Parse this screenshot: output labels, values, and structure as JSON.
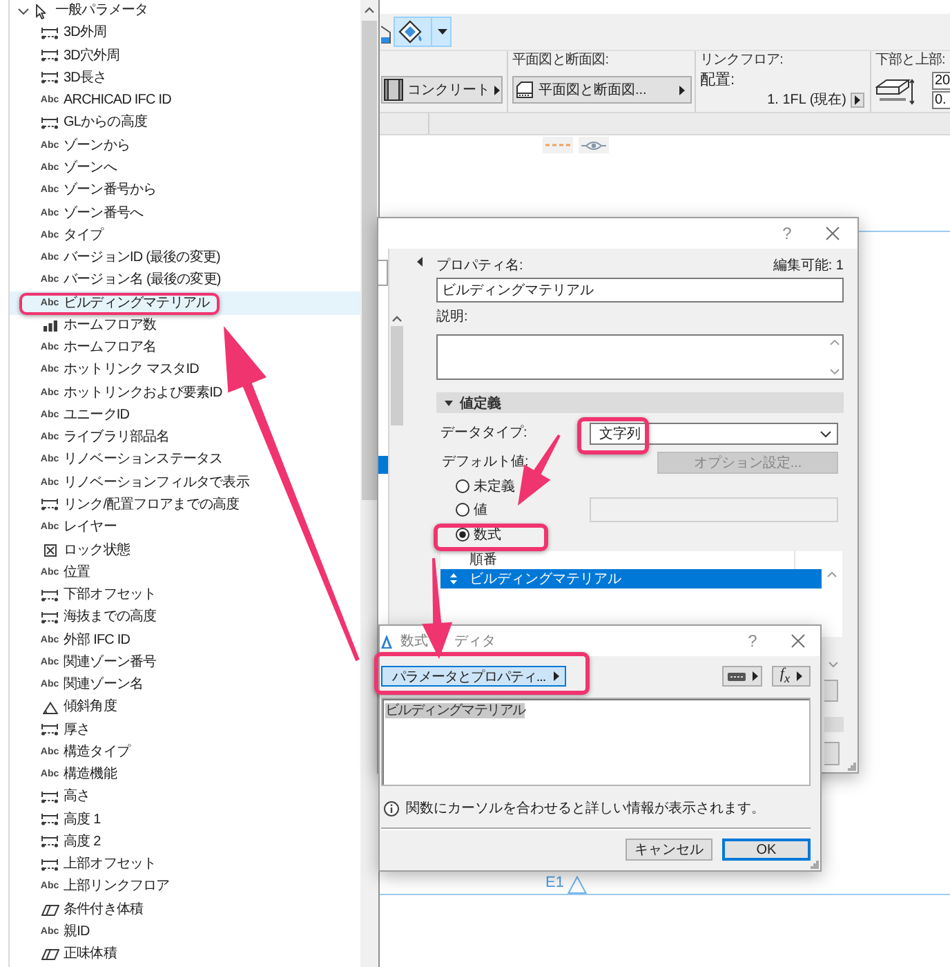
{
  "parameter_tree": [
    {
      "label": "一般パラメータ",
      "expanded": true,
      "children": [
        {
          "label": "3D外周",
          "kind": "length",
          "selected": false,
          "callout": false
        },
        {
          "label": "3D穴外周",
          "kind": "length",
          "selected": false,
          "callout": false
        },
        {
          "label": "3D長さ",
          "kind": "length",
          "selected": false,
          "callout": false
        },
        {
          "label": "ARCHICAD IFC ID",
          "kind": "text",
          "icon_text": "Abc",
          "selected": false,
          "callout": false
        },
        {
          "label": "GLからの高度",
          "kind": "length",
          "selected": false,
          "callout": false
        },
        {
          "label": "ゾーンから",
          "kind": "text",
          "icon_text": "Abc",
          "selected": false,
          "callout": false
        },
        {
          "label": "ゾーンへ",
          "kind": "text",
          "icon_text": "Abc",
          "selected": false,
          "callout": false
        },
        {
          "label": "ゾーン番号から",
          "kind": "text",
          "icon_text": "Abc",
          "selected": false,
          "callout": false
        },
        {
          "label": "ゾーン番号へ",
          "kind": "text",
          "icon_text": "Abc",
          "selected": false,
          "callout": false
        },
        {
          "label": "タイプ",
          "kind": "text",
          "icon_text": "Abc",
          "selected": false,
          "callout": false
        },
        {
          "label": "バージョンID (最後の変更)",
          "kind": "text",
          "icon_text": "Abc",
          "selected": false,
          "callout": false
        },
        {
          "label": "バージョン名 (最後の変更)",
          "kind": "text",
          "icon_text": "Abc",
          "selected": false,
          "callout": false
        },
        {
          "label": "ビルディングマテリアル",
          "kind": "text",
          "icon_text": "Abc",
          "selected": true,
          "callout": true
        },
        {
          "label": "ホームフロア数",
          "kind": "count",
          "selected": false,
          "callout": false
        },
        {
          "label": "ホームフロア名",
          "kind": "text",
          "icon_text": "Abc",
          "selected": false,
          "callout": false
        },
        {
          "label": "ホットリンク マスタID",
          "kind": "text",
          "icon_text": "Abc",
          "selected": false,
          "callout": false
        },
        {
          "label": "ホットリンクおよび要素ID",
          "kind": "text",
          "icon_text": "Abc",
          "selected": false,
          "callout": false
        },
        {
          "label": "ユニークID",
          "kind": "text",
          "icon_text": "Abc",
          "selected": false,
          "callout": false
        },
        {
          "label": "ライブラリ部品名",
          "kind": "text",
          "icon_text": "Abc",
          "selected": false,
          "callout": false
        },
        {
          "label": "リノベーションステータス",
          "kind": "text",
          "icon_text": "Abc",
          "selected": false,
          "callout": false
        },
        {
          "label": "リノベーションフィルタで表示",
          "kind": "text",
          "icon_text": "Abc",
          "selected": false,
          "callout": false
        },
        {
          "label": "リンク/配置フロアまでの高度",
          "kind": "length",
          "selected": false,
          "callout": false
        },
        {
          "label": "レイヤー",
          "kind": "text",
          "icon_text": "Abc",
          "selected": false,
          "callout": false
        },
        {
          "label": "ロック状態",
          "kind": "lock",
          "selected": false,
          "callout": false
        },
        {
          "label": "位置",
          "kind": "text",
          "icon_text": "Abc",
          "selected": false,
          "callout": false
        },
        {
          "label": "下部オフセット",
          "kind": "length",
          "selected": false,
          "callout": false
        },
        {
          "label": "海抜までの高度",
          "kind": "length",
          "selected": false,
          "callout": false
        },
        {
          "label": "外部 IFC ID",
          "kind": "text",
          "icon_text": "Abc",
          "selected": false,
          "callout": false
        },
        {
          "label": "関連ゾーン番号",
          "kind": "text",
          "icon_text": "Abc",
          "selected": false,
          "callout": false
        },
        {
          "label": "関連ゾーン名",
          "kind": "text",
          "icon_text": "Abc",
          "selected": false,
          "callout": false
        },
        {
          "label": "傾斜角度",
          "kind": "angle",
          "selected": false,
          "callout": false
        },
        {
          "label": "厚さ",
          "kind": "length",
          "selected": false,
          "callout": false
        },
        {
          "label": "構造タイプ",
          "kind": "text",
          "icon_text": "Abc",
          "selected": false,
          "callout": false
        },
        {
          "label": "構造機能",
          "kind": "text",
          "icon_text": "Abc",
          "selected": false,
          "callout": false
        },
        {
          "label": "高さ",
          "kind": "length",
          "selected": false,
          "callout": false
        },
        {
          "label": "高度 1",
          "kind": "length",
          "selected": false,
          "callout": false
        },
        {
          "label": "高度 2",
          "kind": "length",
          "selected": false,
          "callout": false
        },
        {
          "label": "上部オフセット",
          "kind": "length",
          "selected": false,
          "callout": false
        },
        {
          "label": "上部リンクフロア",
          "kind": "text",
          "icon_text": "Abc",
          "selected": false,
          "callout": false
        },
        {
          "label": "条件付き体積",
          "kind": "volume",
          "selected": false,
          "callout": false
        },
        {
          "label": "親ID",
          "kind": "text",
          "icon_text": "Abc",
          "selected": false,
          "callout": false
        },
        {
          "label": "正味体積",
          "kind": "volume",
          "selected": false,
          "callout": false
        }
      ]
    }
  ],
  "toolbar": {
    "buttons": [
      {
        "kind": "house",
        "selected": false
      },
      {
        "kind": "fill",
        "selected": true
      }
    ]
  },
  "info_box": {
    "material": {
      "label": "コンクリート"
    },
    "floor_plan": {
      "caption": "平面図と断面図:",
      "button": "平面図と断面図..."
    },
    "link_floor": {
      "caption": "リンクフロア:",
      "label": "配置:",
      "value": "1. 1FL (現在)"
    },
    "top_bottom": {
      "caption": "下部と上部:",
      "fields": [
        "20",
        "0."
      ]
    }
  },
  "canvas": {
    "elevation_marker": {
      "label": "E1"
    }
  },
  "property_dialog": {
    "help": "?",
    "name_label": "プロパティ名:",
    "edit_status": "編集可能: 1",
    "name_value": "ビルディングマテリアル",
    "description_label": "説明:",
    "section": {
      "label": "値定義",
      "expanded": true
    },
    "data_type_label": "データタイプ:",
    "data_type": {
      "value": "文字列",
      "callout": true
    },
    "default_label": "デフォルト値:",
    "options_button": {
      "label": "オプション設定...",
      "disabled": true
    },
    "default_options": [
      {
        "label": "未定義",
        "selected": false,
        "callout": false
      },
      {
        "label": "値",
        "selected": false,
        "callout": false
      },
      {
        "label": "数式",
        "selected": true,
        "callout": true
      }
    ],
    "value_field": {
      "disabled": true
    },
    "order_table": {
      "header": "順番",
      "rows": [
        {
          "label": "ビルディングマテリアル",
          "selected": true
        }
      ]
    }
  },
  "formula_editor": {
    "title_parts": [
      "数式",
      "ディタ"
    ],
    "help": "?",
    "parameter_button": {
      "label": "パラメータとプロパティ...",
      "callout": true
    },
    "function_button": {
      "label": "f$_{x}$"
    },
    "formula": {
      "text": "ビルディングマテリアル",
      "selected": true
    },
    "info": "関数にカーソルを合わせると詳しい情報が表示されます。",
    "buttons": [
      {
        "label": "キャンセル",
        "default": false
      },
      {
        "label": "OK",
        "default": true
      }
    ]
  }
}
